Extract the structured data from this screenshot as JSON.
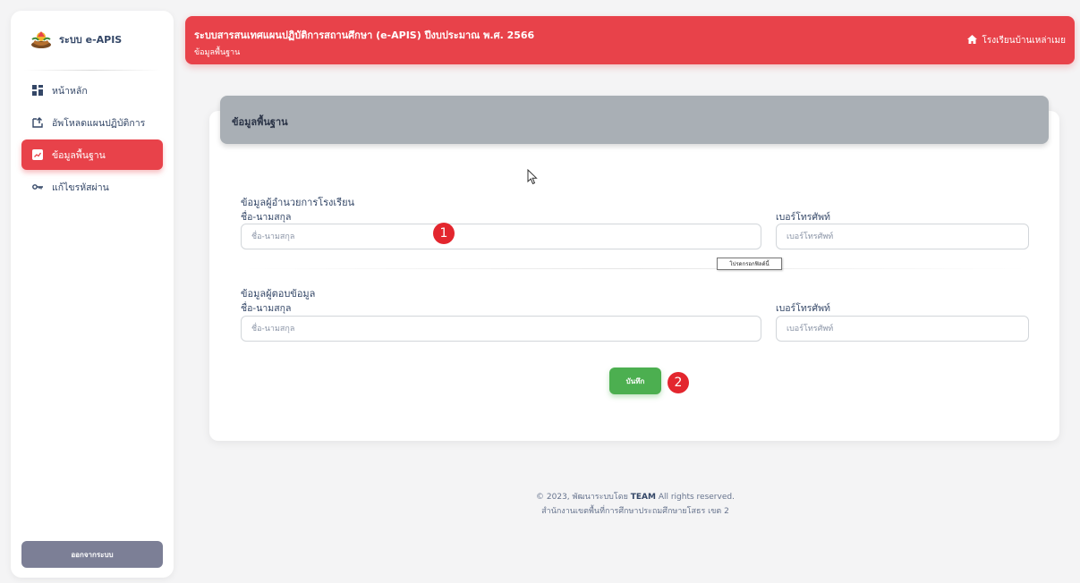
{
  "sidebar": {
    "brand": "ระบบ e-APIS",
    "items": [
      {
        "label": "หน้าหลัก",
        "icon": "dashboard-icon",
        "active": false
      },
      {
        "label": "อัพโหลดแผนปฏิบัติการ",
        "icon": "upload-icon",
        "active": false
      },
      {
        "label": "ข้อมูลพื้นฐาน",
        "icon": "chart-icon",
        "active": true
      },
      {
        "label": "แก้ไขรหัสผ่าน",
        "icon": "key-icon",
        "active": false
      }
    ],
    "logout_label": "ออกจากระบบ"
  },
  "banner": {
    "title": "ระบบสารสนเทศแผนปฏิบัติการสถานศึกษา (e-APIS) ปีงบประมาณ พ.ศ. 2566",
    "subtitle": "ข้อมูลพื้นฐาน",
    "school": "โรงเรียนบ้านเหล่าเมย"
  },
  "card": {
    "title": "ข้อมูลพื้นฐาน",
    "sections": [
      {
        "heading": "ข้อมูลผู้อำนวยการโรงเรียน",
        "name_label": "ชื่อ-นามสกุล",
        "name_placeholder": "ชื่อ-นามสกุล",
        "name_value": "",
        "phone_label": "เบอร์โทรศัพท์",
        "phone_placeholder": "เบอร์โทรศัพท์",
        "phone_value": ""
      },
      {
        "heading": "ข้อมูลผู้ตอบข้อมูล",
        "name_label": "ชื่อ-นามสกุล",
        "name_placeholder": "ชื่อ-นามสกุล",
        "name_value": "",
        "phone_label": "เบอร์โทรศัพท์",
        "phone_placeholder": "เบอร์โทรศัพท์",
        "phone_value": ""
      }
    ],
    "tooltip": "โปรดกรอกฟิลด์นี้",
    "save_label": "บันทึก"
  },
  "markers": [
    "1",
    "2"
  ],
  "footer": {
    "prefix": "© 2023, พัฒนาระบบโดย",
    "team": "TEAM",
    "suffix": "All rights reserved.",
    "line2": "สำนักงานเขตพื้นที่การศึกษาประถมศึกษายโสธร เขต 2"
  },
  "colors": {
    "accent": "#e8424a",
    "save": "#4caf50",
    "header": "#a9afb5",
    "marker": "#e3262e",
    "logout": "#7c7f96"
  }
}
